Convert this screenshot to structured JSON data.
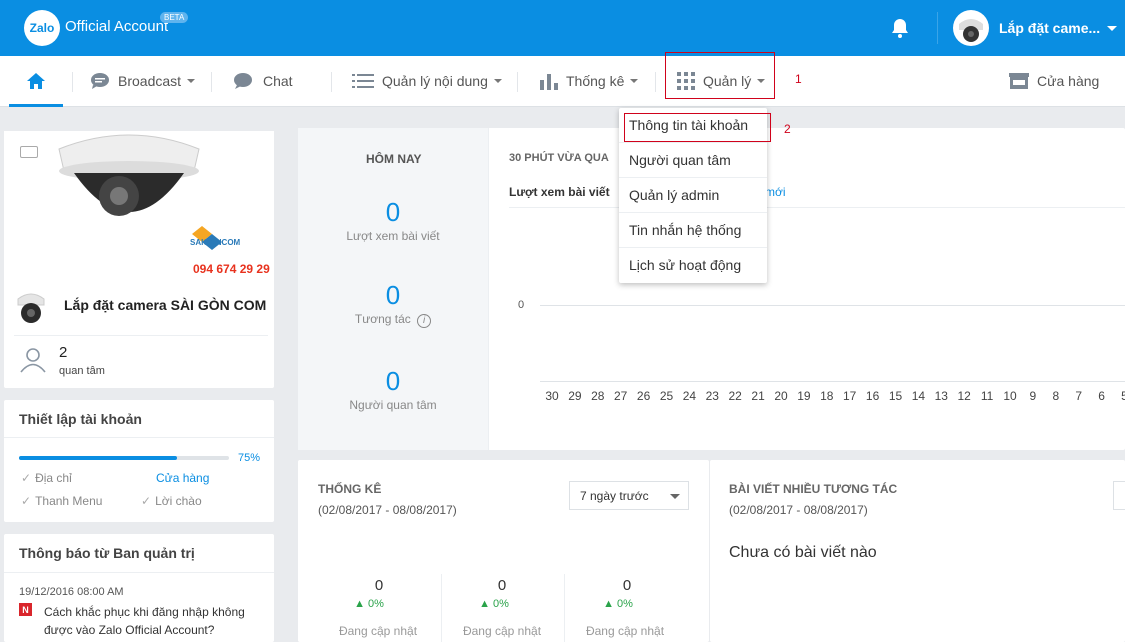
{
  "brand": {
    "title": "Official Account",
    "beta": "BETA",
    "logo": "Zalo"
  },
  "header": {
    "account_name": "Lắp đặt came..."
  },
  "nav": {
    "items": [
      {
        "label": "Broadcast"
      },
      {
        "label": "Chat"
      },
      {
        "label": "Quản lý nội dung"
      },
      {
        "label": "Thống kê"
      },
      {
        "label": "Quản lý"
      },
      {
        "label": "Cửa hàng"
      }
    ],
    "annotation_1": "1"
  },
  "dropdown": {
    "items": [
      "Thông tin tài khoản",
      "Người quan tâm",
      "Quản lý admin",
      "Tin nhắn hệ thống",
      "Lịch sử hoạt động"
    ],
    "annotation_2": "2"
  },
  "profile": {
    "brand_text": "SAIGONCOM",
    "phone": "094 674 29 29",
    "name": "Lắp đặt camera SÀI GÒN COM",
    "followers": "2",
    "followers_label": "quan tâm"
  },
  "setup": {
    "title": "Thiết lập tài khoản",
    "progress": 0.75,
    "progress_label": "75%",
    "items": [
      "Địa chỉ",
      "Cửa hàng",
      "Thanh Menu",
      "Lời chào"
    ]
  },
  "notice": {
    "title": "Thông báo từ Ban quản trị",
    "date": "19/12/2016 08:00 AM",
    "badge": "N",
    "text": "Cách khắc phục khi đăng nhập không được vào Zalo Official Account?"
  },
  "today": {
    "title": "HÔM NAY",
    "stats": [
      {
        "value": "0",
        "label": "Lượt xem bài viết"
      },
      {
        "value": "0",
        "label": "Tương tác"
      },
      {
        "value": "0",
        "label": "Người quan tâm"
      }
    ]
  },
  "recent": {
    "title": "30 PHÚT VỪA QUA",
    "tab_active": "Lượt xem bài viết",
    "tab_other": "mới",
    "zero": "0",
    "ticks": [
      "30",
      "29",
      "28",
      "27",
      "26",
      "25",
      "24",
      "23",
      "22",
      "21",
      "20",
      "19",
      "18",
      "17",
      "16",
      "15",
      "14",
      "13",
      "12",
      "11",
      "10",
      "9",
      "8",
      "7",
      "6",
      "5"
    ]
  },
  "stats_panel": {
    "title": "THỐNG KÊ",
    "range": "(02/08/2017 - 08/08/2017)",
    "select_value": "7 ngày trước",
    "items": [
      {
        "value": "0",
        "pct": "0%",
        "label": "Đang cập nhật"
      },
      {
        "value": "0",
        "pct": "0%",
        "label": "Đang cập nhật"
      },
      {
        "value": "0",
        "pct": "0%",
        "label": "Đang cập nhật"
      }
    ]
  },
  "posts_panel": {
    "title": "BÀI VIẾT NHIỀU TƯƠNG TÁC",
    "range": "(02/08/2017 - 08/08/2017)",
    "empty": "Chưa có bài viết nào"
  },
  "colors": {
    "primary": "#0a8ee2",
    "annotation": "#d0021b"
  }
}
